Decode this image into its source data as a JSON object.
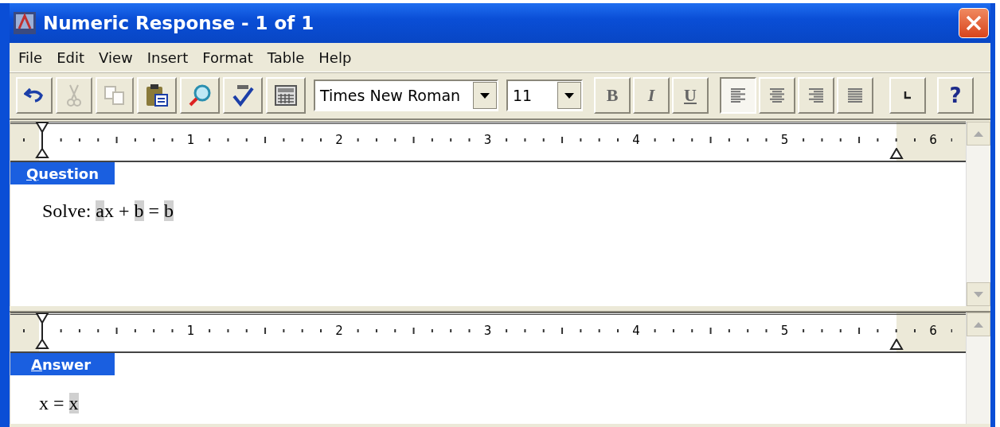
{
  "window": {
    "title": "Numeric Response - 1 of 1"
  },
  "menu": [
    "File",
    "Edit",
    "View",
    "Insert",
    "Format",
    "Table",
    "Help"
  ],
  "toolbar": {
    "tools": [
      {
        "kind": "undo",
        "disabled": false
      },
      {
        "kind": "cut",
        "disabled": true
      },
      {
        "kind": "copy",
        "disabled": true
      },
      {
        "kind": "paste",
        "disabled": false
      },
      {
        "kind": "find",
        "disabled": false
      },
      {
        "kind": "spelling",
        "disabled": false
      },
      {
        "kind": "calculator",
        "disabled": false
      }
    ],
    "font": {
      "value": "Times New Roman"
    },
    "size": {
      "value": "11"
    },
    "styles": [
      {
        "kind": "bold",
        "label": "B"
      },
      {
        "kind": "italic",
        "label": "I"
      },
      {
        "kind": "underline",
        "label": "U"
      }
    ],
    "align": [
      {
        "kind": "left",
        "selected": true
      },
      {
        "kind": "center",
        "selected": false
      },
      {
        "kind": "right",
        "selected": false
      },
      {
        "kind": "justify",
        "selected": false
      }
    ],
    "help": {
      "label": "?"
    }
  },
  "sections": [
    {
      "label": "Question",
      "ruler": [
        "1",
        "2",
        "3",
        "4",
        "5",
        "6"
      ],
      "scroll_down": true,
      "content": [
        {
          "text": "Solve: "
        },
        {
          "text": "a",
          "kind": "field"
        },
        {
          "text": "x + "
        },
        {
          "text": "b",
          "kind": "field"
        },
        {
          "text": " = "
        },
        {
          "text": "b",
          "kind": "field"
        }
      ]
    },
    {
      "label": "Answer",
      "ruler": [
        "1",
        "2",
        "3",
        "4",
        "5",
        "6"
      ],
      "scroll_down": false,
      "content": [
        {
          "text": "x = "
        },
        {
          "text": "x",
          "kind": "field"
        }
      ]
    }
  ]
}
